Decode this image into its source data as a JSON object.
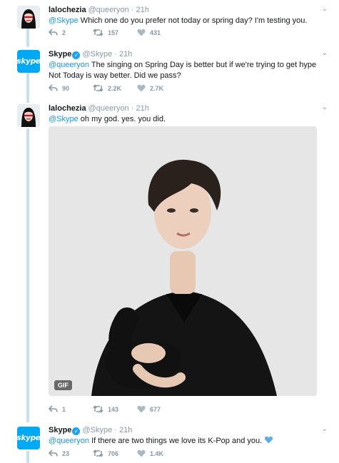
{
  "tweets": [
    {
      "name": "lalochezia",
      "handle": "@queeryon",
      "time": "21h",
      "mention": "@Skype",
      "text": " Which one do you prefer not today or spring day? I'm testing you.",
      "replies": "2",
      "retweets": "157",
      "likes": "431"
    },
    {
      "name": "Skype",
      "handle": "@Skype",
      "time": "21h",
      "mention": "@queeryon",
      "text_line1": " The singing on Spring Day is better but if we're trying to get hype",
      "text_line2": "Not Today is way better. Did we pass?",
      "replies": "90",
      "retweets": "2.2K",
      "likes": "2.7K"
    },
    {
      "name": "lalochezia",
      "handle": "@queeryon",
      "time": "21h",
      "mention": "@Skype",
      "text": " oh my god. yes. you did.",
      "media_badge": "GIF",
      "replies": "1",
      "retweets": "143",
      "likes": "677"
    },
    {
      "name": "Skype",
      "handle": "@Skype",
      "time": "21h",
      "mention": "@queeryon",
      "text": " If there are two things we love its K-Pop and you.",
      "replies": "23",
      "retweets": "706",
      "likes": "1.4K"
    }
  ],
  "avatar_skype_label": "skype",
  "colors": {
    "accent": "#1da1f2",
    "link": "#1b95e0",
    "muted": "#8899a6",
    "thread": "#c5e0f3",
    "skype": "#01a9f4"
  }
}
